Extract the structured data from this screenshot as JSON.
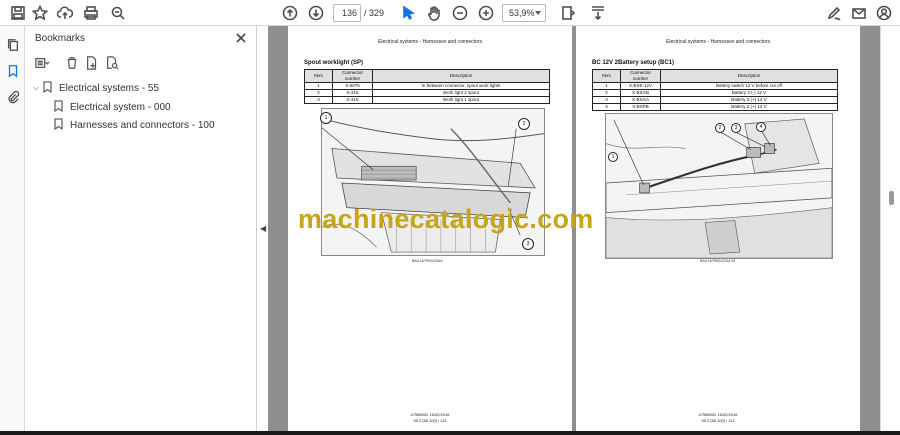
{
  "toolbar": {
    "page_current": "136",
    "page_total": "/ 329",
    "zoom": "53,9%"
  },
  "bookmarks": {
    "title": "Bookmarks",
    "items": [
      {
        "label": "Electrical systems - 55",
        "level": 0,
        "expanded": true
      },
      {
        "label": "Electrical system - 000",
        "level": 1
      },
      {
        "label": "Harnesses and connectors - 100",
        "level": 1
      }
    ]
  },
  "pages": [
    {
      "header": "Electrical systems - Harnesses and connectors",
      "section_title": "Spout worklight (SP)",
      "columns": [
        "Item",
        "Connector number",
        "Description"
      ],
      "rows": [
        [
          "1",
          "X-5075",
          "In between   connector, spout work lights"
        ],
        [
          "2",
          "X-318",
          "Work light 2 spout"
        ],
        [
          "3",
          "X-319",
          "Work light 1 spout"
        ]
      ],
      "callouts": [
        "1",
        "2",
        "3"
      ],
      "figure_code": "BAIL14FR00420AA",
      "footer_code": "47585502 16/02/2016",
      "footer_page": "55.2 [55.100] / 112"
    },
    {
      "header": "Electrical systems - Harnesses and connectors",
      "section_title": "BC 12V 2Battery setup (BC1)",
      "columns": [
        "Item",
        "Connector number",
        "Description"
      ],
      "rows": [
        [
          "1",
          "X-BSE-12V",
          "Battery switch 12 V before cut off"
        ],
        [
          "2",
          "X-BSGB",
          "Battery 3 (-) 12 V"
        ],
        [
          "3",
          "X-BSGA",
          "Battery 3 (+) 12 V"
        ],
        [
          "4",
          "X-BSPB",
          "Battery 2 (+) 12 V"
        ]
      ],
      "callouts": [
        "1",
        "2",
        "3",
        "4"
      ],
      "figure_code": "BAIL14FR00422AA   02",
      "footer_code": "47585502 16/02/2016",
      "footer_page": "55.2 [55.100] / 113"
    }
  ],
  "watermark": "machinecatalogic.com"
}
